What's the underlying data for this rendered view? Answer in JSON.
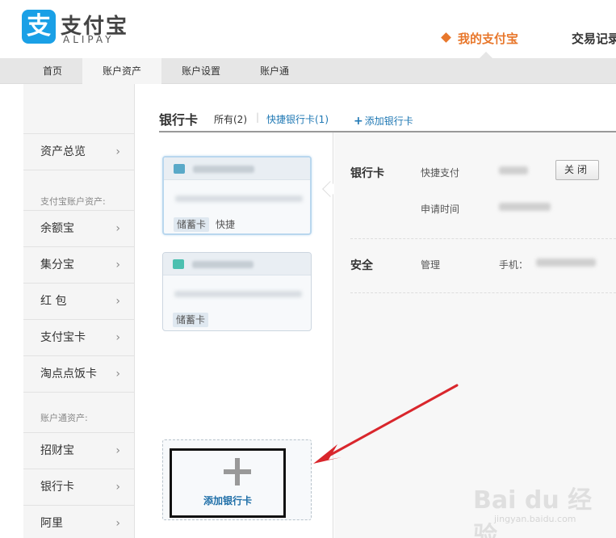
{
  "brand": {
    "icon_char": "支",
    "name_cn": "支付宝",
    "name_en": "ALIPAY"
  },
  "topnav": {
    "current": "我的支付宝",
    "other": "交易记录"
  },
  "subnav": {
    "tabs": [
      {
        "label": "首页"
      },
      {
        "label": "账户资产"
      },
      {
        "label": "账户设置"
      },
      {
        "label": "账户通"
      }
    ]
  },
  "sidebar": {
    "overview": "资产总览",
    "cat1": "支付宝账户资产:",
    "items1": [
      "余额宝",
      "集分宝",
      "红 包",
      "支付宝卡",
      "淘点点饭卡"
    ],
    "cat2": "账户通资产:",
    "items2": [
      "招财宝",
      "银行卡",
      "阿里"
    ],
    "arrow": "›"
  },
  "main": {
    "title": "银行卡",
    "tab_all": "所有(2)",
    "separator": "|",
    "tab_quick": "快捷银行卡(1)",
    "add_link": "添加银行卡",
    "add_plus": "+"
  },
  "cards": [
    {
      "tag": "储蓄卡",
      "tag2": "快捷",
      "icon_color": "#5aa9c8"
    },
    {
      "tag": "储蓄卡",
      "icon_color": "#4cc0b0"
    }
  ],
  "detail": {
    "bank_label": "银行卡",
    "quick_pay": "快捷支付",
    "close_button": "关闭",
    "apply_time": "申请时间",
    "security_label": "安全",
    "manage": "管理",
    "phone": "手机："
  },
  "add_card": {
    "label": "添加银行卡"
  },
  "watermark": {
    "text": "Bai du 经验",
    "url": "jingyan.baidu.com"
  },
  "colors": {
    "brand_blue": "#1aa0e6",
    "accent_orange": "#e8772b",
    "link_blue": "#1f78b4",
    "annotation_red": "#d9262c"
  }
}
